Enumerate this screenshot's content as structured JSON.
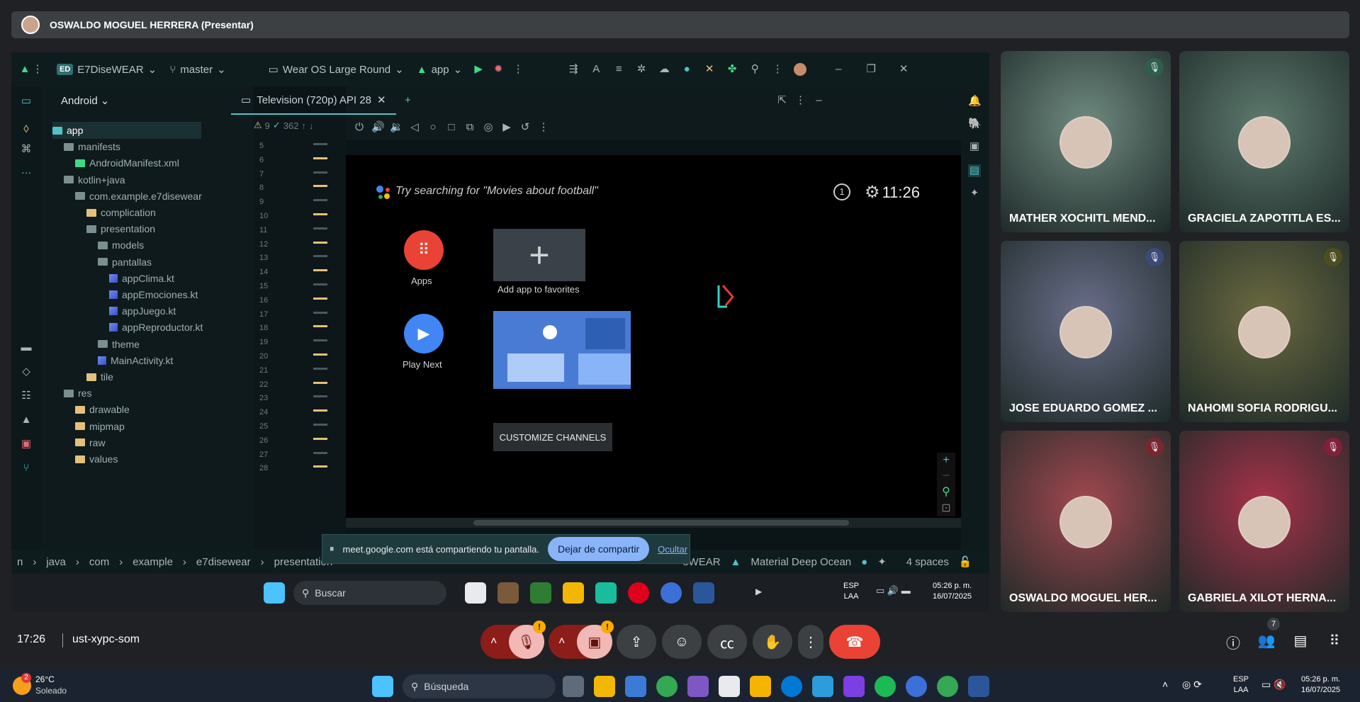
{
  "presenter_bar": {
    "name": "OSWALDO MOGUEL HERRERA (Presentar)"
  },
  "ide": {
    "project": "E7DiseWEAR",
    "project_badge": "ED",
    "branch": "master",
    "device": "Wear OS Large Round",
    "run_config": "app",
    "project_view": "Android",
    "emulator_tab": "Television (720p) API 28",
    "problems": "9",
    "warnings": "362",
    "tree": [
      {
        "label": "app",
        "indent": 0,
        "kind": "module"
      },
      {
        "label": "manifests",
        "indent": 1,
        "kind": "folder"
      },
      {
        "label": "AndroidManifest.xml",
        "indent": 2,
        "kind": "file"
      },
      {
        "label": "kotlin+java",
        "indent": 1,
        "kind": "folder"
      },
      {
        "label": "com.example.e7disewear",
        "indent": 2,
        "kind": "package"
      },
      {
        "label": "complication",
        "indent": 3,
        "kind": "folder"
      },
      {
        "label": "presentation",
        "indent": 3,
        "kind": "package"
      },
      {
        "label": "models",
        "indent": 4,
        "kind": "folder"
      },
      {
        "label": "pantallas",
        "indent": 4,
        "kind": "package"
      },
      {
        "label": "appClima.kt",
        "indent": 5,
        "kind": "kt"
      },
      {
        "label": "appEmociones.kt",
        "indent": 5,
        "kind": "kt"
      },
      {
        "label": "appJuego.kt",
        "indent": 5,
        "kind": "kt"
      },
      {
        "label": "appReproductor.kt",
        "indent": 5,
        "kind": "kt"
      },
      {
        "label": "theme",
        "indent": 4,
        "kind": "folder"
      },
      {
        "label": "MainActivity.kt",
        "indent": 4,
        "kind": "kt"
      },
      {
        "label": "tile",
        "indent": 3,
        "kind": "folder"
      },
      {
        "label": "res",
        "indent": 1,
        "kind": "folder"
      },
      {
        "label": "drawable",
        "indent": 2,
        "kind": "folder"
      },
      {
        "label": "mipmap",
        "indent": 2,
        "kind": "folder"
      },
      {
        "label": "raw",
        "indent": 2,
        "kind": "folder"
      },
      {
        "label": "values",
        "indent": 2,
        "kind": "folder"
      }
    ],
    "line_numbers": [
      "5",
      "6",
      "7",
      "8",
      "9",
      "10",
      "11",
      "12",
      "13",
      "14",
      "15",
      "16",
      "17",
      "18",
      "19",
      "20",
      "21",
      "22",
      "23",
      "24",
      "25",
      "26",
      "27",
      "28"
    ],
    "statusbar": {
      "breadcrumb": [
        "n",
        "java",
        "com",
        "example",
        "e7disewear",
        "presentation"
      ],
      "module_fragment": "eWEAR",
      "theme": "Material Deep Ocean",
      "indent": "4 spaces"
    }
  },
  "tv": {
    "search_hint": "Try searching for \"Movies about football\"",
    "time": "11:26",
    "apps_label": "Apps",
    "add_app_label": "Add app to favorites",
    "play_next_label": "Play Next",
    "customize_label": "CUSTOMIZE CHANNELS"
  },
  "share_notice": {
    "text": "meet.google.com está compartiendo tu pantalla.",
    "stop_label": "Dejar de compartir",
    "hide_label": "Ocultar"
  },
  "inner_taskbar": {
    "search": "Buscar",
    "lang": "ESP",
    "lang2": "LAA",
    "time": "05:26 p. m.",
    "date": "16/07/2025"
  },
  "participants": [
    {
      "name": "MATHER XOCHITL MEND...",
      "bg": "#6f8a80",
      "mic": "#2e5e4e"
    },
    {
      "name": "GRACIELA ZAPOTITLA ES...",
      "bg": "#5d7a6e",
      "mic": ""
    },
    {
      "name": "JOSE EDUARDO GOMEZ ...",
      "bg": "#6a6e8a",
      "mic": "#3c4a78"
    },
    {
      "name": "NAHOMI SOFIA RODRIGU...",
      "bg": "#6b6a40",
      "mic": "#4e4d20"
    },
    {
      "name": "OSWALDO MOGUEL HER...",
      "bg": "#a24850",
      "mic": "#7a2630"
    },
    {
      "name": "GABRIELA XILOT HERNA...",
      "bg": "#a8324a",
      "mic": "#80203a"
    }
  ],
  "meeting": {
    "clock": "17:26",
    "code": "ust-xypc-som",
    "people_count": "7",
    "warning": "!"
  },
  "win_taskbar": {
    "weather_temp": "26°C",
    "weather_desc": "Soleado",
    "weather_badge": "2",
    "search": "Búsqueda",
    "lang": "ESP",
    "lang2": "LAA",
    "time": "05:26 p. m.",
    "date": "16/07/2025"
  }
}
